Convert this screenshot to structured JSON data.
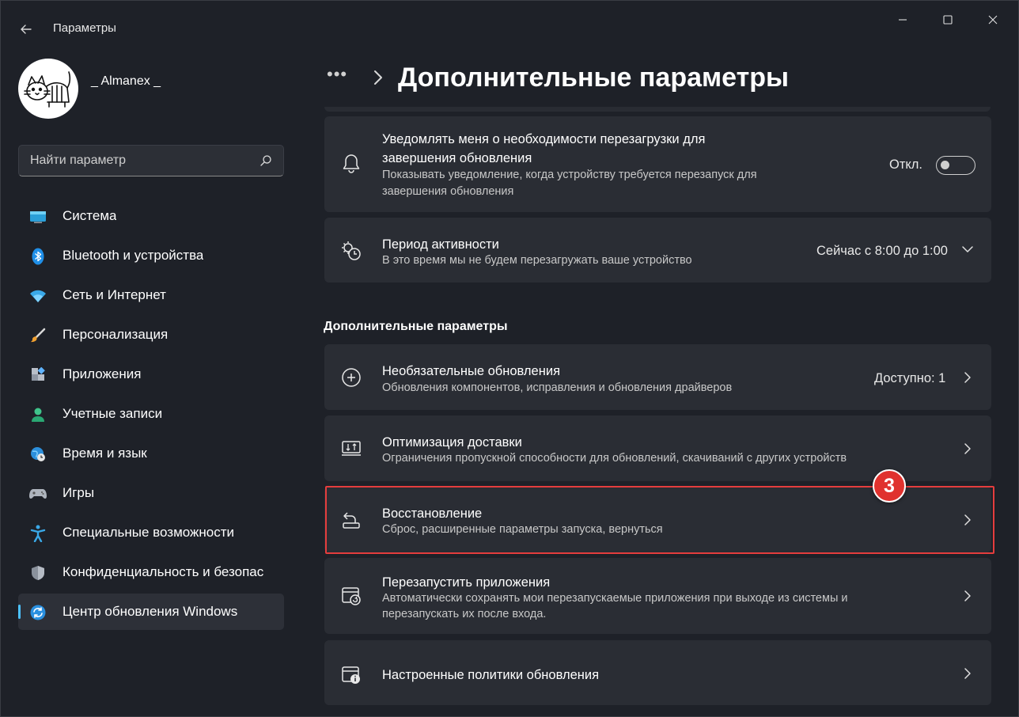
{
  "window": {
    "title": "Параметры"
  },
  "user": {
    "name": "_ Almanex _"
  },
  "search": {
    "placeholder": "Найти параметр"
  },
  "sidebar": {
    "items": [
      {
        "label": "Система",
        "icon": "system-icon"
      },
      {
        "label": "Bluetooth и устройства",
        "icon": "bluetooth-icon"
      },
      {
        "label": "Сеть и Интернет",
        "icon": "wifi-icon"
      },
      {
        "label": "Персонализация",
        "icon": "brush-icon"
      },
      {
        "label": "Приложения",
        "icon": "apps-icon"
      },
      {
        "label": "Учетные записи",
        "icon": "person-icon"
      },
      {
        "label": "Время и язык",
        "icon": "globe-clock-icon"
      },
      {
        "label": "Игры",
        "icon": "gamepad-icon"
      },
      {
        "label": "Специальные возможности",
        "icon": "accessibility-icon"
      },
      {
        "label": "Конфиденциальность и безопас",
        "icon": "shield-icon"
      },
      {
        "label": "Центр обновления Windows",
        "icon": "windows-update-icon",
        "active": true
      }
    ]
  },
  "header": {
    "breadcrumb_dots": "•••",
    "title": "Дополнительные параметры"
  },
  "cards": {
    "notify": {
      "title": "Уведомлять меня о необходимости перезагрузки для завершения обновления",
      "title_line1": "Уведомлять меня о необходимости перезагрузки для",
      "title_line2": "завершения обновления",
      "desc_line1": "Показывать уведомление, когда устройству требуется перезапуск для",
      "desc_line2": "завершения обновления",
      "toggle_label": "Откл.",
      "toggle_on": false
    },
    "active_hours": {
      "title": "Период активности",
      "desc": "В это время мы не будем перезагружать ваше устройство",
      "value": "Сейчас с 8:00 до 1:00"
    }
  },
  "section": {
    "title": "Дополнительные параметры"
  },
  "advanced": {
    "optional": {
      "title": "Необязательные обновления",
      "desc": "Обновления компонентов, исправления и обновления драйверов",
      "value": "Доступно: 1"
    },
    "delivery": {
      "title": "Оптимизация доставки",
      "desc": "Ограничения пропускной способности для обновлений, скачиваний с других устройств"
    },
    "recovery": {
      "title": "Восстановление",
      "desc": "Сброс, расширенные параметры запуска, вернуться"
    },
    "restart_apps": {
      "title": "Перезапустить приложения",
      "desc_line1": "Автоматически сохранять мои перезапускаемые приложения при выходе из системы и",
      "desc_line2": "перезапускать их после входа."
    },
    "policies": {
      "title": "Настроенные политики обновления"
    }
  },
  "annotation": {
    "step": "3",
    "color": "#e0322e"
  },
  "colors": {
    "accent": "#4cc2ff",
    "background": "#1e2128",
    "card": "#2a2d34",
    "highlight_border": "#e53d3d"
  }
}
